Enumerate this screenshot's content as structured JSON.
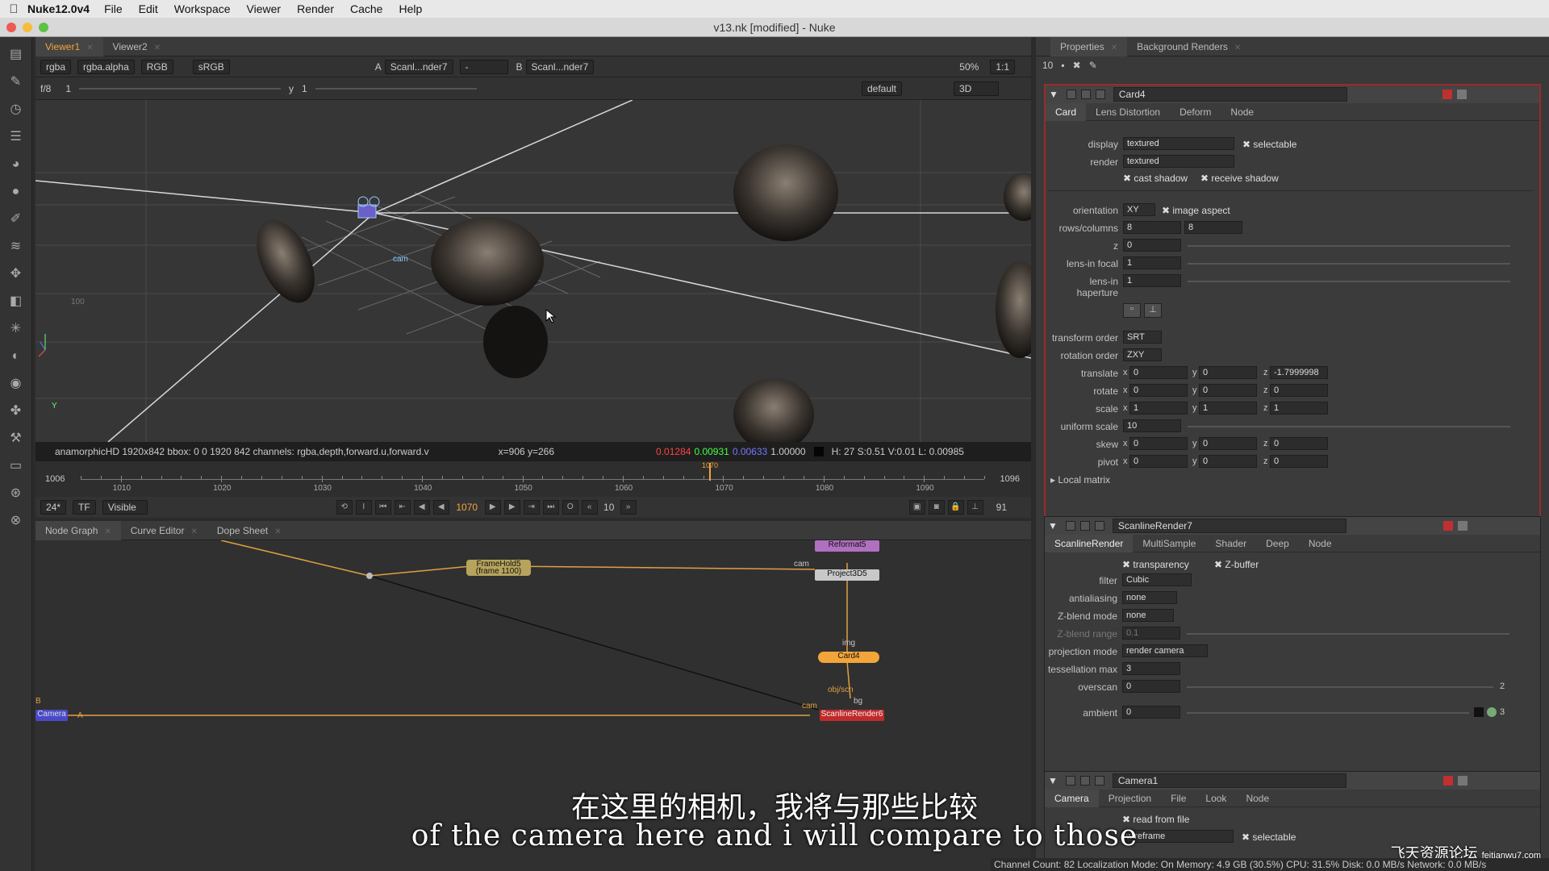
{
  "menubar": {
    "app": "Nuke12.0v4",
    "items": [
      "File",
      "Edit",
      "Workspace",
      "Viewer",
      "Render",
      "Cache",
      "Help"
    ]
  },
  "window": {
    "title": "v13.nk [modified] - Nuke"
  },
  "viewer_tabs": [
    "Viewer1",
    "Viewer2"
  ],
  "viewer_bar": {
    "channels": "rgba",
    "alpha": "rgba.alpha",
    "rgb": "RGB",
    "lut": "sRGB",
    "a_label": "A",
    "a_input": "Scanl...nder7",
    "a_sel": "-",
    "b_label": "B",
    "b_input": "Scanl...nder7",
    "zoom": "50%",
    "ratio": "1:1"
  },
  "viewer_bar2": {
    "fstop": "f/8",
    "frame": "1",
    "y_label": "y",
    "y_val": "1",
    "view": "default",
    "mode": "3D"
  },
  "viewport": {
    "grid_label": "100",
    "axis_label": "Y",
    "cam_label": "cam"
  },
  "info": {
    "format": "anamorphicHD 1920x842  bbox: 0 0 1920 842 channels: rgba,depth,forward.u,forward.v",
    "coords": "x=906 y=266",
    "r": "0.01284",
    "g": "0.00931",
    "b": "0.00633",
    "a": "1.00000",
    "hsvl": "H: 27 S:0.51 V:0.01  L: 0.00985"
  },
  "timeline": {
    "start": "1006",
    "end": "1096",
    "ticks": [
      "1006",
      "1010",
      "1020",
      "1030",
      "1040",
      "1050",
      "1060",
      "1070",
      "1080",
      "1090",
      "1096"
    ],
    "current": "1070"
  },
  "transport": {
    "fps": "24*",
    "tf": "TF",
    "visible": "Visible",
    "frame": "1070",
    "step": "10",
    "end": "91"
  },
  "graph_tabs": [
    "Node Graph",
    "Curve Editor",
    "Dope Sheet"
  ],
  "nodes": {
    "reformat": "Reformat5",
    "project": "Project3D5",
    "framehold": "FrameHold5",
    "framehold_sub": "(frame 1100)",
    "card": "Card4",
    "scanline": "ScanlineRender6",
    "camera": "Camera",
    "cam1": "cam",
    "img": "img",
    "objscn": "obj/scn",
    "bg": "bg",
    "cam2": "cam",
    "b": "B",
    "a": "A"
  },
  "props_tabs": [
    "Properties",
    "Background Renders"
  ],
  "props_toolbar": {
    "count": "10"
  },
  "card": {
    "name": "Card4",
    "tabs": [
      "Card",
      "Lens Distortion",
      "Deform",
      "Node"
    ],
    "display": "textured",
    "selectable": "selectable",
    "render": "textured",
    "cast": "cast shadow",
    "receive": "receive shadow",
    "orientation": "XY",
    "image_aspect": "image aspect",
    "rows": "8",
    "cols": "8",
    "z": "0",
    "focal": "1",
    "haperture": "1",
    "transform_order": "SRT",
    "rotation_order": "ZXY",
    "translate": [
      "0",
      "0",
      "-1.7999998"
    ],
    "rotate": [
      "0",
      "0",
      "0"
    ],
    "scale": [
      "1",
      "1",
      "1"
    ],
    "uniform": "10",
    "skew": [
      "0",
      "0",
      "0"
    ],
    "pivot": [
      "0",
      "0",
      "0"
    ],
    "local": "Local matrix",
    "labels": {
      "display": "display",
      "render": "render",
      "orientation": "orientation",
      "rows": "rows/columns",
      "z": "z",
      "focal": "lens-in focal",
      "haperture": "lens-in haperture",
      "to": "transform order",
      "ro": "rotation order",
      "translate": "translate",
      "rotate": "rotate",
      "scale": "scale",
      "uniform": "uniform scale",
      "skew": "skew",
      "pivot": "pivot"
    }
  },
  "scan": {
    "name": "ScanlineRender7",
    "tabs": [
      "ScanlineRender",
      "MultiSample",
      "Shader",
      "Deep",
      "Node"
    ],
    "transparency": "transparency",
    "zbuffer": "Z-buffer",
    "filter": "Cubic",
    "aa": "none",
    "zblend": "none",
    "zrange": "0.1",
    "proj": "render camera",
    "tess": "3",
    "overscan": "0",
    "overscan2": "2",
    "ambient": "0",
    "ambient_n": "3",
    "labels": {
      "filter": "filter",
      "aa": "antialiasing",
      "zblend": "Z-blend mode",
      "zrange": "Z-blend range",
      "proj": "projection mode",
      "tess": "tessellation max",
      "overscan": "overscan",
      "ambient": "ambient"
    }
  },
  "camera": {
    "name": "Camera1",
    "tabs": [
      "Camera",
      "Projection",
      "File",
      "Look",
      "Node"
    ],
    "read": "read from file",
    "display": "wireframe",
    "selectable": "selectable"
  },
  "subtitle": {
    "cn": "在这里的相机，我将与那些比较",
    "en": "of the camera here and i will compare to those"
  },
  "watermark": {
    "cn": "飞天资源论坛",
    "url": "feitianwu7.com"
  },
  "status": "Channel Count: 82  Localization Mode: On  Memory: 4.9 GB (30.5%)  CPU: 31.5%  Disk: 0.0 MB/s  Network: 0.0 MB/s"
}
